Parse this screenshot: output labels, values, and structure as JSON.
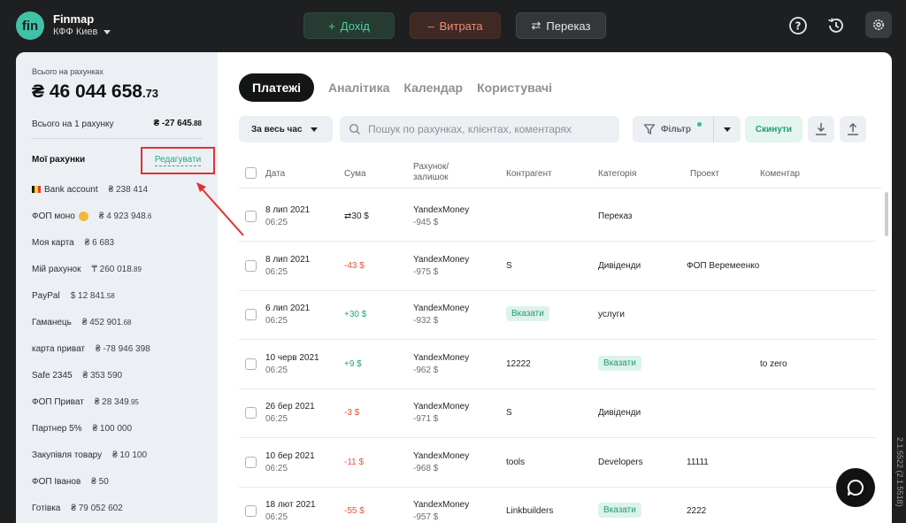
{
  "header": {
    "logo_text": "fin",
    "app_name": "Finmap",
    "company": "КФФ Киев",
    "income_label": "Дохід",
    "expense_label": "Витрата",
    "transfer_label": "Переказ"
  },
  "sidebar": {
    "total_label": "Всього на рахунках",
    "total_main": "₴ 46 044 658",
    "total_dec": ".73",
    "one_label": "Всього на 1 рахунку",
    "one_main": "₴ -27 645",
    "one_dec": ".88",
    "accounts_title": "Мої рахунки",
    "edit_label": "Редагувати",
    "accounts": [
      {
        "name": "Bank account",
        "val": "₴ 238 414",
        "dec": ""
      },
      {
        "name": "ФОП моно",
        "val": "₴ 4 923 948",
        "dec": ".6"
      },
      {
        "name": "Моя карта",
        "val": "₴ 6 683",
        "dec": ""
      },
      {
        "name": "Мій рахунок",
        "val": "₸ 260 018",
        "dec": ".89"
      },
      {
        "name": "PayPal",
        "val": "$ 12 841",
        "dec": ".58"
      },
      {
        "name": "Гаманець",
        "val": "₴ 452 901",
        "dec": ".68"
      },
      {
        "name": "карта приват",
        "val": "₴ -78 946 398",
        "dec": ""
      },
      {
        "name": "Safe 2345",
        "val": "₴ 353 590",
        "dec": ""
      },
      {
        "name": "ФОП Приват",
        "val": "₴ 28 349",
        "dec": ".95"
      },
      {
        "name": "Партнер 5%",
        "val": "₴ 100 000",
        "dec": ""
      },
      {
        "name": "Закупівля товару",
        "val": "₴ 10 100",
        "dec": ""
      },
      {
        "name": "ФОП Іванов",
        "val": "₴ 50",
        "dec": ""
      },
      {
        "name": "Готівка",
        "val": "₴ 79 052 602",
        "dec": ""
      }
    ]
  },
  "tabs": [
    "Платежі",
    "Аналітика",
    "Календар",
    "Користувачі"
  ],
  "toolbar": {
    "period": "За весь час",
    "search_placeholder": "Пошук по рахунках, клієнтах, коментарях",
    "filter_label": "Фільтр",
    "reset_label": "Скинути"
  },
  "table": {
    "headers": {
      "date": "Дата",
      "amount": "Сума",
      "account_1": "Рахунок/",
      "account_2": "залишок",
      "counterparty": "Контрагент",
      "category": "Категорія",
      "project": "Проект",
      "comment": "Коментар"
    },
    "rows": [
      {
        "date": "8 лип 2021",
        "time": "06:25",
        "amount": "⇄30 $",
        "amount_type": "neu",
        "account": "YandexMoney",
        "balance": "-945 $",
        "counterparty": "",
        "counterparty_tag": false,
        "category": "Переказ",
        "category_tag": false,
        "project": "",
        "comment": ""
      },
      {
        "date": "8 лип 2021",
        "time": "06:25",
        "amount": "-43 $",
        "amount_type": "neg",
        "account": "YandexMoney",
        "balance": "-975 $",
        "counterparty": "S",
        "counterparty_tag": false,
        "category": "Дивіденди",
        "category_tag": false,
        "project": "ФОП Веремеенко",
        "comment": ""
      },
      {
        "date": "6 лип 2021",
        "time": "06:25",
        "amount": "+30 $",
        "amount_type": "pos",
        "account": "YandexMoney",
        "balance": "-932 $",
        "counterparty": "Вказати",
        "counterparty_tag": true,
        "category": "услуги",
        "category_tag": false,
        "project": "",
        "comment": ""
      },
      {
        "date": "10 черв 2021",
        "time": "06:25",
        "amount": "+9 $",
        "amount_type": "pos",
        "account": "YandexMoney",
        "balance": "-962 $",
        "counterparty": "12222",
        "counterparty_tag": false,
        "category": "Вказати",
        "category_tag": true,
        "project": "",
        "comment": "to zero"
      },
      {
        "date": "26 бер 2021",
        "time": "06:25",
        "amount": "-3 $",
        "amount_type": "neg",
        "account": "YandexMoney",
        "balance": "-971 $",
        "counterparty": "S",
        "counterparty_tag": false,
        "category": "Дивіденди",
        "category_tag": false,
        "project": "",
        "comment": ""
      },
      {
        "date": "10 бер 2021",
        "time": "06:25",
        "amount": "-11 $",
        "amount_type": "neg",
        "account": "YandexMoney",
        "balance": "-968 $",
        "counterparty": "tools",
        "counterparty_tag": false,
        "category": "Developers",
        "category_tag": false,
        "project": "11111",
        "comment": ""
      },
      {
        "date": "18 лют 2021",
        "time": "06:25",
        "amount": "-55 $",
        "amount_type": "neg",
        "account": "YandexMoney",
        "balance": "-957 $",
        "counterparty": "Linkbuilders",
        "counterparty_tag": false,
        "category": "Вказати",
        "category_tag": true,
        "project": "2222",
        "comment": ""
      }
    ]
  },
  "version": "2.1.5522 (2.1.5518)",
  "colors": {
    "accent": "#41c2a6",
    "negative": "#e8543a",
    "positive": "#1ea77e",
    "highlight": "#e03232"
  }
}
